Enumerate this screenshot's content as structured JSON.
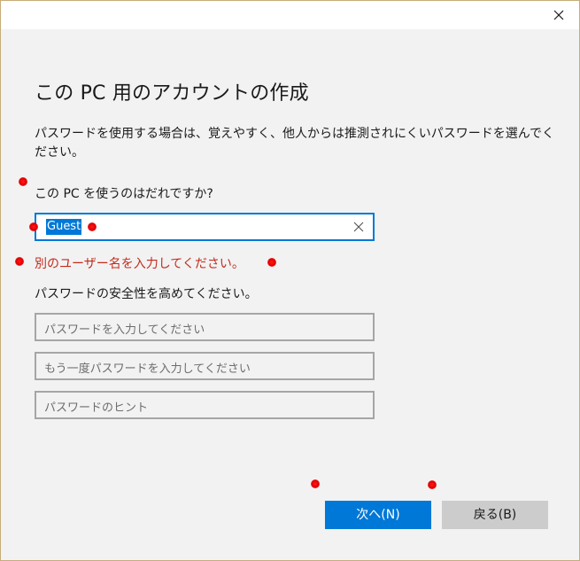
{
  "window": {
    "close_glyph": "✕"
  },
  "heading": "この PC 用のアカウントの作成",
  "description": "パスワードを使用する場合は、覚えやすく、他人からは推測されにくいパスワードを選んでください。",
  "who_label": "この PC を使うのはだれですか?",
  "username": {
    "value": "Guest"
  },
  "error": "別のユーザー名を入力してください。",
  "password_label": "パスワードの安全性を高めてください。",
  "fields": {
    "password_placeholder": "パスワードを入力してください",
    "confirm_placeholder": "もう一度パスワードを入力してください",
    "hint_placeholder": "パスワードのヒント"
  },
  "buttons": {
    "next": "次へ(N)",
    "back": "戻る(B)"
  },
  "colors": {
    "accent": "#0078d7",
    "error": "#c42b1c",
    "marker": "#ff0000"
  }
}
